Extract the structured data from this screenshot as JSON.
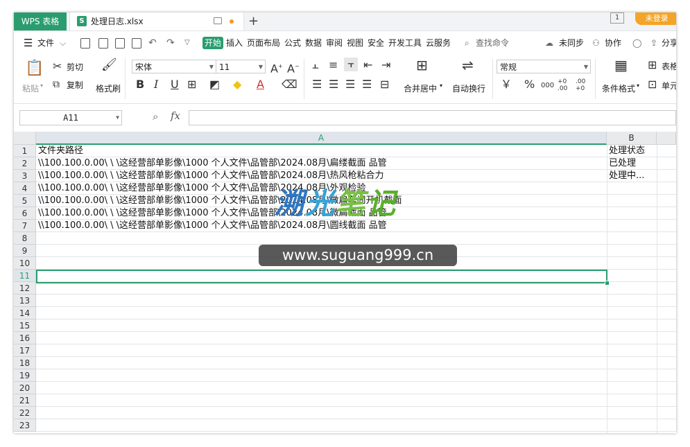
{
  "titlebar": {
    "app_tab": "WPS 表格",
    "doc_icon_letter": "S",
    "doc_name": "处理日志.xlsx",
    "new_tab": "+",
    "counter": "1",
    "login": "未登录"
  },
  "menu": {
    "file": "文件",
    "file_arrow": "⌵",
    "items": [
      "开始",
      "插入",
      "页面布局",
      "公式",
      "数据",
      "审阅",
      "视图",
      "安全",
      "开发工具",
      "云服务"
    ],
    "search": "查找命令",
    "sync": "未同步",
    "collab": "协作",
    "share": "分享"
  },
  "ribbon": {
    "paste": "粘贴",
    "cut": "剪切",
    "copy": "复制",
    "format_painter": "格式刷",
    "font_name": "宋体",
    "font_size": "11",
    "bold": "B",
    "italic": "I",
    "underline": "U",
    "font_color_glyph": "A",
    "merge_center": "合并居中",
    "wrap_text": "自动换行",
    "number_format": "常规",
    "currency": "￥",
    "percent": "%",
    "thousands": "000",
    "dec_increase": "+0 .00",
    "dec_decrease": ".00 +0",
    "conditional_format": "条件格式",
    "table_style": "表格",
    "cell_style": "单元"
  },
  "formula_bar": {
    "name_box": "A11",
    "fx": "fx",
    "value": ""
  },
  "sheet": {
    "columns": [
      "A",
      "B"
    ],
    "selected_column": "A",
    "selected_row": "11",
    "row_numbers": [
      "1",
      "2",
      "3",
      "4",
      "5",
      "6",
      "7",
      "8",
      "9",
      "10",
      "11",
      "12",
      "13",
      "14",
      "15",
      "16",
      "17",
      "18",
      "19",
      "20",
      "21",
      "22",
      "23"
    ],
    "rows": [
      {
        "a": "文件夹路径",
        "b": "处理状态"
      },
      {
        "a": "\\\\100.100.0.00\\  \\ \\这经营部单影像\\1000 个人文件\\品管部\\2024.08月\\扁缕截面 品管",
        "b": "已处理"
      },
      {
        "a": "\\\\100.100.0.00\\  \\ \\这经营部单影像\\1000 个人文件\\品管部\\2024.08月\\热风枪粘合力",
        "b": "处理中..."
      },
      {
        "a": "\\\\100.100.0.00\\  \\ \\这经营部单影像\\1000 个人文件\\品管部\\2024.08月\\外观检验",
        "b": ""
      },
      {
        "a": "\\\\100.100.0.00\\  \\ \\这经营部单影像\\1000 个人文件\\品管部\\2024.08月\\微扁车间开机截面",
        "b": ""
      },
      {
        "a": "\\\\100.100.0.00\\  \\ \\这经营部单影像\\1000 个人文件\\品管部\\2024.08月\\微扁截面  品管",
        "b": ""
      },
      {
        "a": "\\\\100.100.0.00\\  \\ \\这经营部单影像\\1000 个人文件\\品管部\\2024.08月\\圆线截面 品管",
        "b": ""
      }
    ]
  },
  "watermark": {
    "logo_1": "溯",
    "logo_2": "光",
    "logo_3": "笔",
    "logo_4": "记",
    "url": "www.suguang999.cn"
  },
  "colors": {
    "accent": "#2a9d6f",
    "login": "#f4a426"
  }
}
